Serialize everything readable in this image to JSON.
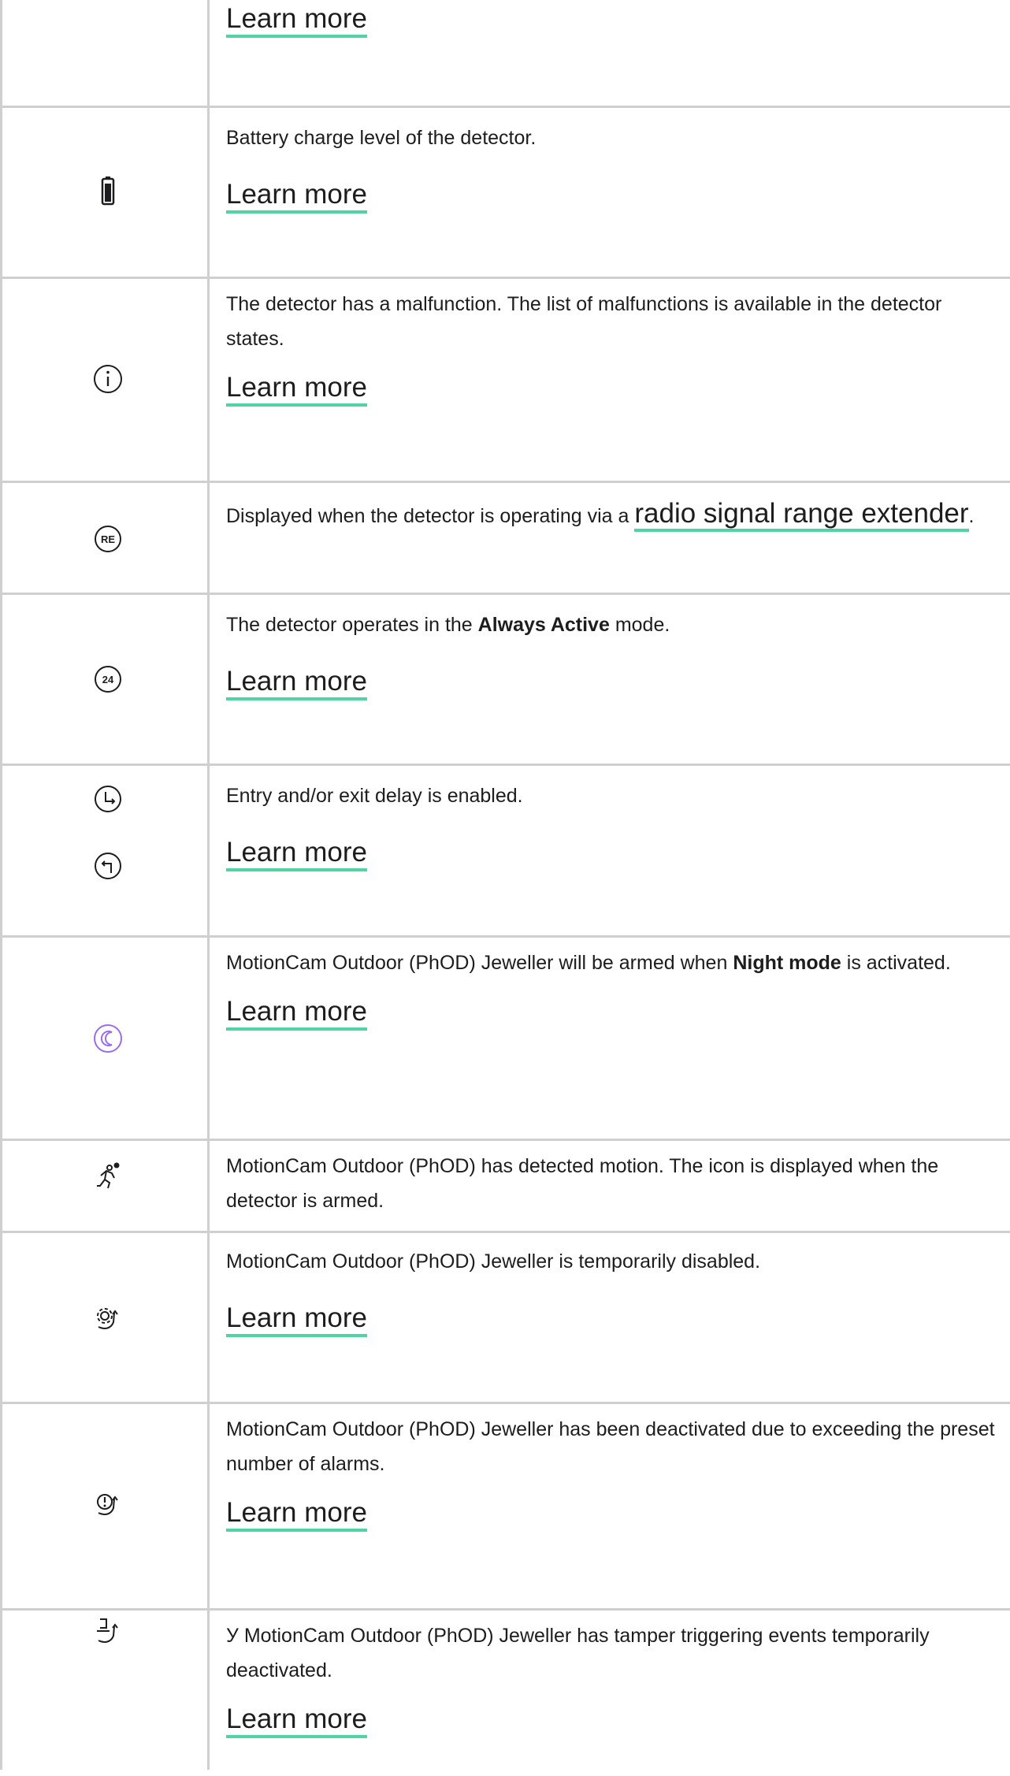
{
  "colors": {
    "accent_underline": "#4fd5a4",
    "night_mode_icon": "#9b6cf2",
    "border": "#cfcfcf",
    "text": "#1d1d1f"
  },
  "rows": [
    {
      "icon": "none",
      "description": "",
      "link": "Learn more"
    },
    {
      "icon": "battery-icon",
      "description": "Battery charge level of the detector.",
      "link": "Learn more"
    },
    {
      "icon": "info-icon",
      "description": "The detector has a malfunction. The list of malfunctions is available in the detector states.",
      "link": "Learn more"
    },
    {
      "icon": "range-extender-icon",
      "icon_text": "RE",
      "description_prefix": "Displayed when the detector is operating via a",
      "description_link": "radio signal range extender",
      "description_suffix": "."
    },
    {
      "icon": "always-active-icon",
      "icon_text": "24",
      "description_prefix": "The detector operates in the",
      "description_bold": "Always Active",
      "description_suffix": "mode.",
      "link": "Learn more"
    },
    {
      "icon": "entry-exit-delay-icons",
      "description": "Entry and/or exit delay is enabled.",
      "link": "Learn more"
    },
    {
      "icon": "night-mode-icon",
      "description_prefix": "MotionCam Outdoor (PhOD) Jeweller will be armed when",
      "description_bold": "Night mode",
      "description_suffix": "is activated.",
      "link": "Learn more"
    },
    {
      "icon": "motion-detected-icon",
      "description": "MotionCam Outdoor (PhOD) has detected motion. The icon is displayed when the detector is armed."
    },
    {
      "icon": "temporarily-disabled-icon",
      "description": "MotionCam Outdoor (PhOD) Jeweller is temporarily disabled.",
      "link": "Learn more"
    },
    {
      "icon": "deactivated-alarms-icon",
      "description": "MotionCam Outdoor (PhOD) Jeweller has been deactivated due to exceeding the preset number of alarms.",
      "link": "Learn more"
    },
    {
      "icon": "tamper-deactivated-icon",
      "description": "У MotionCam Outdoor (PhOD) Jeweller has tamper triggering events temporarily deactivated.",
      "link": "Learn more"
    }
  ]
}
